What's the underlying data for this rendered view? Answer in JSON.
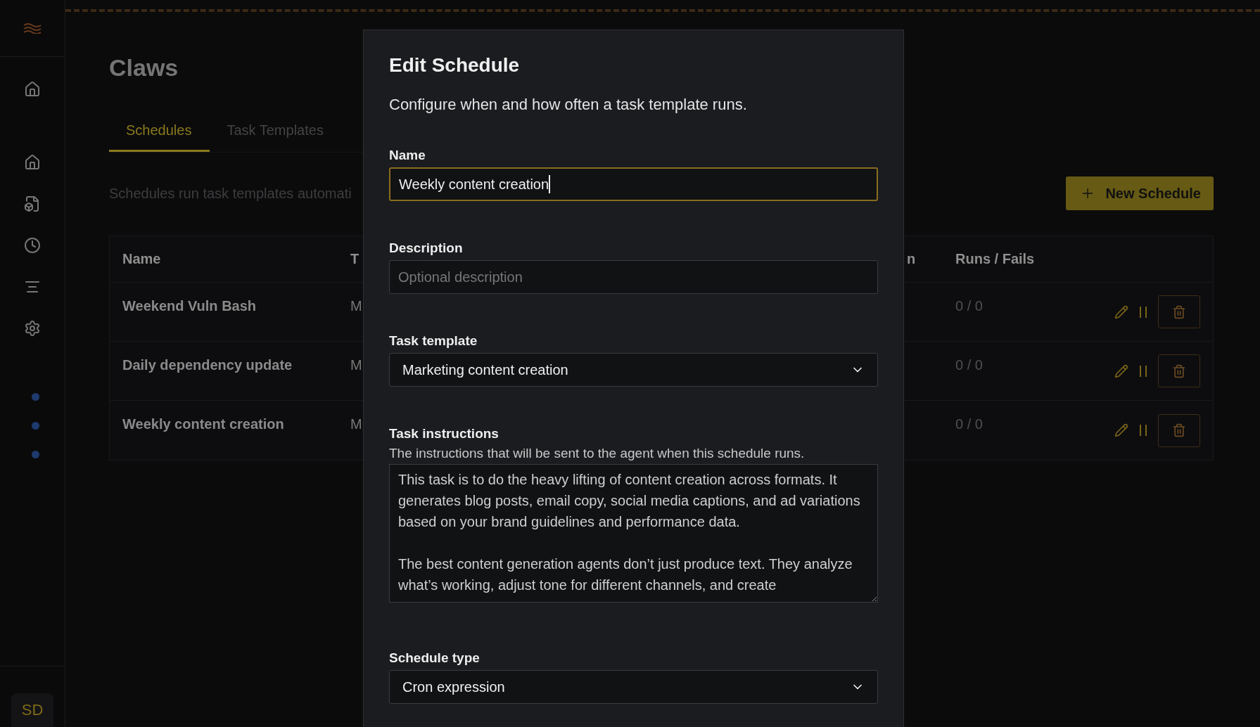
{
  "sidebar": {
    "avatar": "SD",
    "status_dots": [
      {
        "color": "#1e3a6e"
      },
      {
        "color": "#1e3a6e"
      },
      {
        "color": "#1e3a6e"
      }
    ]
  },
  "page": {
    "title": "Claws",
    "tabs": [
      {
        "label": "Schedules",
        "selected": true
      },
      {
        "label": "Task Templates",
        "selected": false
      }
    ],
    "description": "Schedules run task templates automati",
    "new_button": "New Schedule"
  },
  "table": {
    "columns": [
      "Name",
      "T",
      "n",
      "Runs / Fails"
    ],
    "rows": [
      {
        "name": "Weekend Vuln Bash",
        "column_2": "M",
        "runs": "0 / 0"
      },
      {
        "name": "Daily dependency update",
        "column_2": "M",
        "runs": "0 / 0"
      },
      {
        "name": "Weekly content creation",
        "column_2": "M",
        "runs": "0 / 0"
      }
    ]
  },
  "dialog": {
    "title": "Edit Schedule",
    "subtitle": "Configure when and how often a task template runs.",
    "fields": [
      {
        "kind": "text",
        "label": "Name",
        "value": "Weekly content creation",
        "focused": true
      },
      {
        "kind": "text",
        "label": "Description",
        "placeholder": "Optional description",
        "focused": false
      },
      {
        "kind": "select",
        "label": "Task template",
        "value": "Marketing content creation"
      },
      {
        "kind": "textarea",
        "label": "Task instructions",
        "hint": "The instructions that will be sent to the agent when this schedule runs.",
        "value": "This task is to do the heavy lifting of content creation across formats. It generates blog posts, email copy, social media captions, and ad variations based on your brand guidelines and performance data.\n\nThe best content generation agents don’t just produce text. They analyze what’s working, adjust tone for different channels, and create"
      },
      {
        "kind": "select",
        "label": "Schedule type",
        "value": "Cron expression"
      }
    ]
  }
}
